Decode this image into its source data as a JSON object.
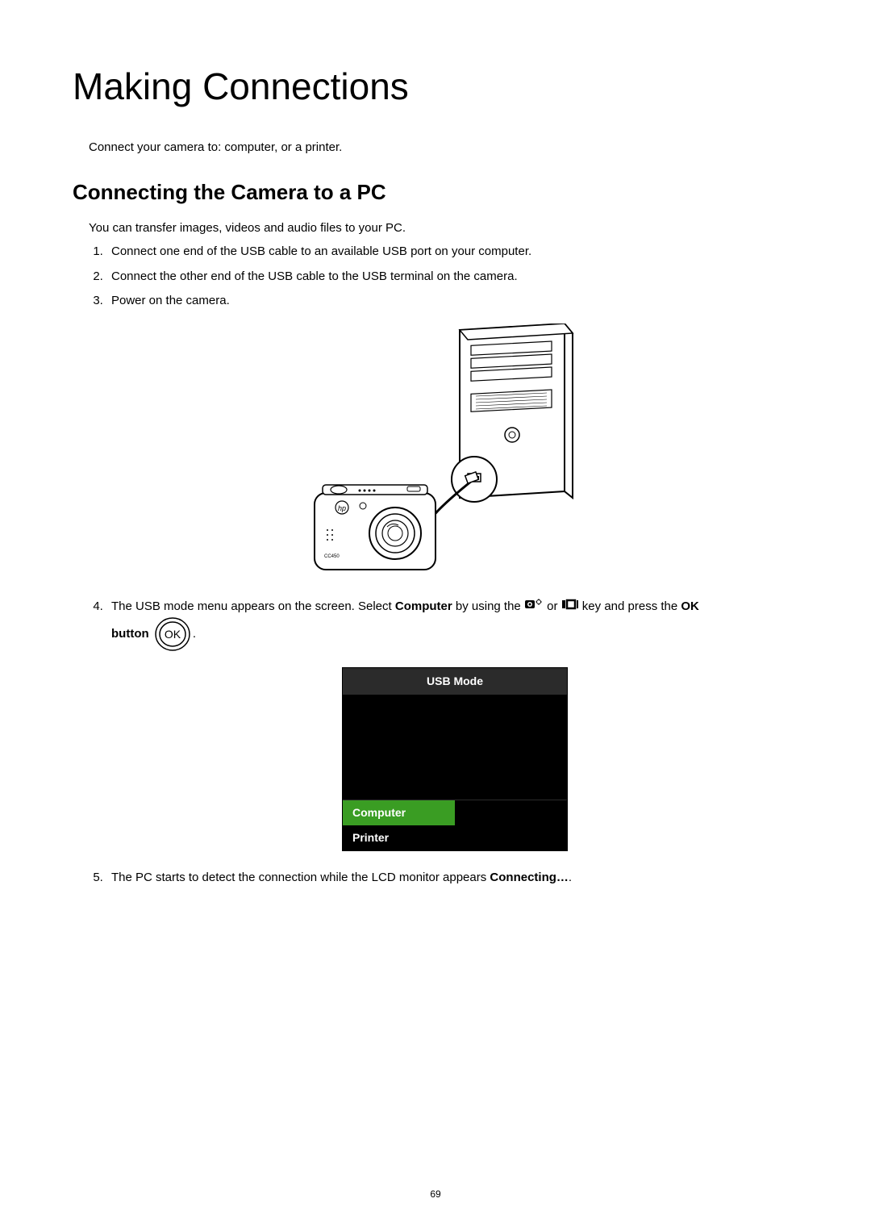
{
  "page": {
    "title": "Making Connections",
    "intro": "Connect your camera to: computer, or a printer.",
    "pageNumber": "69"
  },
  "section": {
    "title": "Connecting the Camera to a PC",
    "intro": "You can transfer images, videos and audio files to your PC.",
    "steps": {
      "s1": "Connect one end of the USB cable to an available USB port on your computer.",
      "s2": "Connect the other end of the USB cable to the USB terminal on the camera.",
      "s3": "Power on the camera.",
      "s4a": "The USB mode menu appears on the screen. Select ",
      "s4_computer": "Computer",
      "s4b": " by using the ",
      "s4c": " or ",
      "s4d": " key and press the ",
      "s4_ok": "OK",
      "s4_button": "button",
      "s4_period": ".",
      "s5a": "The PC starts to detect the connection while the LCD monitor appears ",
      "s5_connecting": "Connecting…",
      "s5b": "."
    }
  },
  "usbMode": {
    "header": "USB Mode",
    "option1": "Computer",
    "option2": "Printer"
  },
  "icons": {
    "okLabel": "OK"
  }
}
